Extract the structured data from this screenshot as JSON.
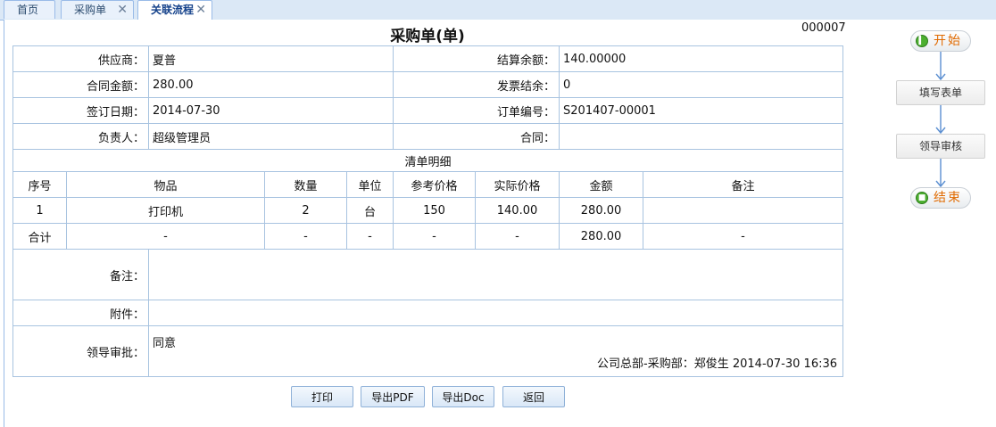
{
  "tabs": [
    {
      "label": "首页"
    },
    {
      "label": "采购单",
      "close": "✕"
    },
    {
      "label": "关联流程",
      "close": "✕"
    }
  ],
  "document": {
    "title": "采购单(单)",
    "number": "000007"
  },
  "fields": {
    "supplier_label": "供应商：",
    "supplier_value": "夏普",
    "balance_label": "结算余额：",
    "balance_value": "140.00000",
    "contract_amount_label": "合同金额：",
    "contract_amount_value": "280.00",
    "invoice_balance_label": "发票结余：",
    "invoice_balance_value": "0",
    "sign_date_label": "签订日期：",
    "sign_date_value": "2014-07-30",
    "order_no_label": "订单编号：",
    "order_no_value": "S201407-00001",
    "owner_label": "负责人：",
    "owner_value": "超级管理员",
    "contract_label": "合同：",
    "contract_value": ""
  },
  "detail": {
    "section_title": "清单明细",
    "columns": [
      "序号",
      "物品",
      "数量",
      "单位",
      "参考价格",
      "实际价格",
      "金额",
      "备注"
    ],
    "rows": [
      [
        "1",
        "打印机",
        "2",
        "台",
        "150",
        "140.00",
        "280.00",
        ""
      ]
    ],
    "total_row": [
      "合计",
      "-",
      "-",
      "-",
      "-",
      "-",
      "280.00",
      "-"
    ]
  },
  "remarks": {
    "remark_label": "备注：",
    "remark_value": "",
    "attachment_label": "附件：",
    "attachment_value": "",
    "approval_label": "领导审批：",
    "approval_value": "同意",
    "approval_signature": "公司总部-采购部：郑俊生  2014-07-30 16:36"
  },
  "buttons": {
    "print": "打印",
    "export_pdf": "导出PDF",
    "export_doc": "导出Doc",
    "back": "返回"
  },
  "flow": {
    "start": "开始",
    "step1": "填写表单",
    "step2": "领导审核",
    "end": "结束",
    "start_icon": "play-circle-icon",
    "end_icon": "stop-circle-icon",
    "arrow_color": "#5b8fd1"
  }
}
